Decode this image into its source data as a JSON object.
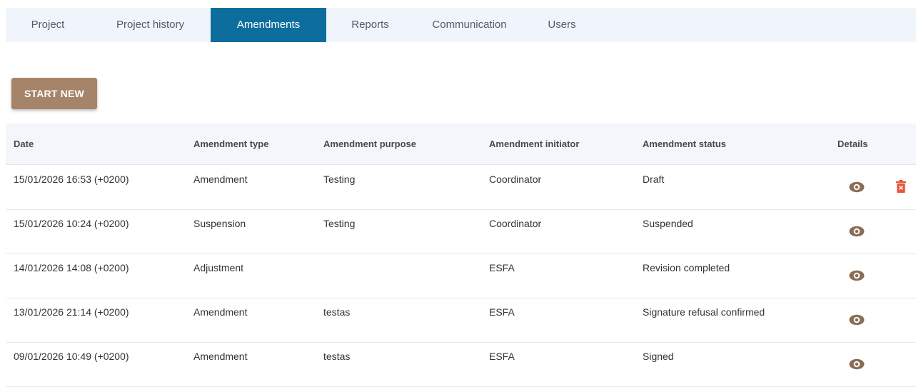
{
  "tabs": [
    {
      "label": "Project",
      "active": false
    },
    {
      "label": "Project history",
      "active": false
    },
    {
      "label": "Amendments",
      "active": true
    },
    {
      "label": "Reports",
      "active": false
    },
    {
      "label": "Communication",
      "active": false
    },
    {
      "label": "Users",
      "active": false
    }
  ],
  "start_button": {
    "label": "START NEW"
  },
  "table": {
    "columns": [
      "Date",
      "Amendment type",
      "Amendment purpose",
      "Amendment initiator",
      "Amendment status",
      "Details"
    ],
    "rows": [
      {
        "date": "15/01/2026 16:53 (+0200)",
        "type": "Amendment",
        "purpose": "Testing",
        "initiator": "Coordinator",
        "status": "Draft",
        "can_delete": true
      },
      {
        "date": "15/01/2026 10:24 (+0200)",
        "type": "Suspension",
        "purpose": "Testing",
        "initiator": "Coordinator",
        "status": "Suspended",
        "can_delete": false
      },
      {
        "date": "14/01/2026 14:08 (+0200)",
        "type": "Adjustment",
        "purpose": "",
        "initiator": "ESFA",
        "status": "Revision completed",
        "can_delete": false
      },
      {
        "date": "13/01/2026 21:14 (+0200)",
        "type": "Amendment",
        "purpose": "testas",
        "initiator": "ESFA",
        "status": "Signature refusal confirmed",
        "can_delete": false
      },
      {
        "date": "09/01/2026 10:49 (+0200)",
        "type": "Amendment",
        "purpose": "testas",
        "initiator": "ESFA",
        "status": "Signed",
        "can_delete": false
      }
    ]
  },
  "colors": {
    "tab_active": "#0d6e9e",
    "button": "#a5846a",
    "view_icon": "#8a6d55",
    "delete_icon": "#e8553a"
  },
  "icons": {
    "view": "eye-icon",
    "delete": "trash-icon"
  }
}
